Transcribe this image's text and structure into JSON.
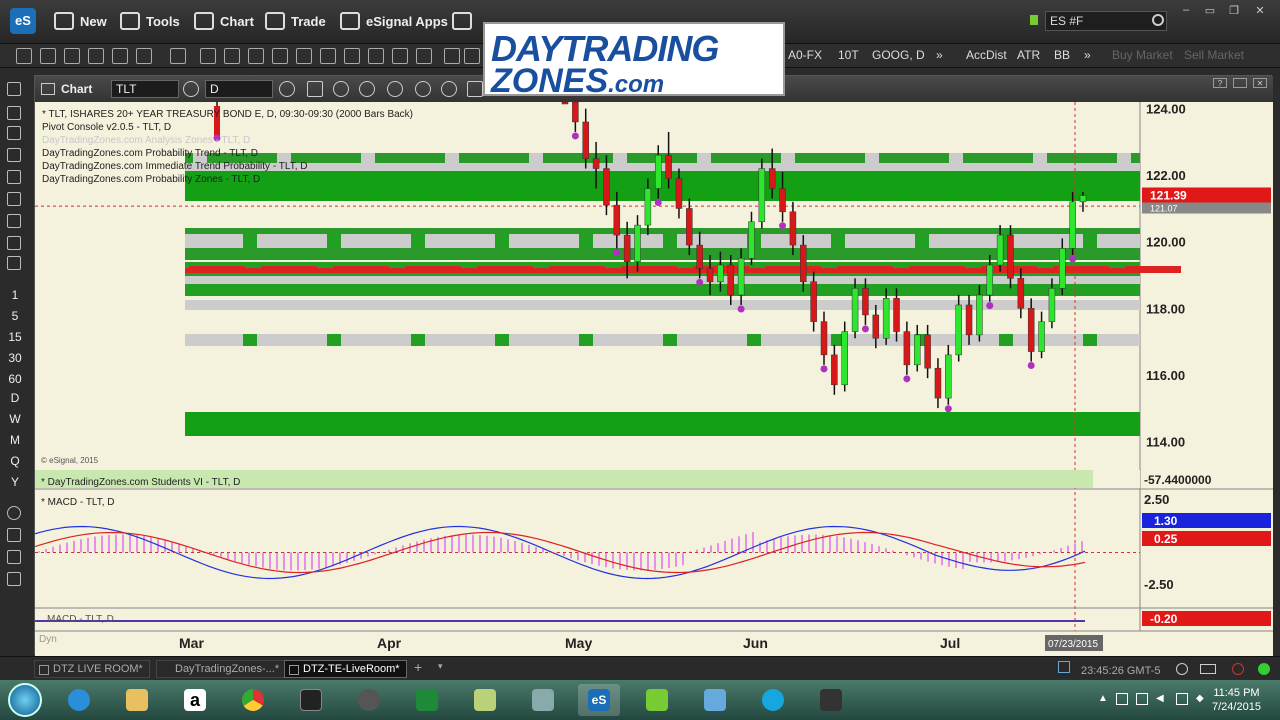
{
  "app": {
    "logo_text": "eS"
  },
  "menu": [
    {
      "label": "New",
      "icon": "new-icon"
    },
    {
      "label": "Tools",
      "icon": "tools-icon"
    },
    {
      "label": "Chart",
      "icon": "chart-icon"
    },
    {
      "label": "Trade",
      "icon": "trade-icon"
    },
    {
      "label": "eSignal Apps",
      "icon": "esignal-apps-icon"
    }
  ],
  "symbol_search": "ES #F",
  "toolbar2": {
    "items": [
      "A0-FX",
      "10T",
      "GOOG, D",
      "AccDist",
      "ATR",
      "BB"
    ],
    "disabled": [
      "Buy Market",
      "Sell Market"
    ]
  },
  "overlay_logo": {
    "line1": "DAYTRADING",
    "line2": "ZONES",
    "suffix": ".com"
  },
  "left_intervals": [
    "1",
    "5",
    "15",
    "30",
    "60",
    "D",
    "W",
    "M",
    "Q",
    "Y"
  ],
  "chart_window": {
    "title": "Chart",
    "symbol": "TLT",
    "interval": "D"
  },
  "legend": {
    "line1": "* TLT, ISHARES 20+ YEAR TREASURY BOND E, D, 09:30-09:30 (2000 Bars Back)",
    "line2": "Pivot Console v2.0.5 - TLT, D",
    "line3": "DayTradingZones.com Analysis Zones - TLT, D",
    "line4": "DayTradingZones.com Probability Trend - TLT, D",
    "line5": "DayTradingZones.com Immediate Trend Probability - TLT, D",
    "line6": "DayTradingZones.com Probability Zones - TLT, D"
  },
  "copyright": "© eSignal, 2015",
  "students_vi": {
    "label": "* DayTradingZones.com Students VI - TLT, D",
    "value": "-57.4400000"
  },
  "macd": {
    "label": "* MACD - TLT, D",
    "upper": "2.50",
    "lower": "-2.50",
    "blue_value": "1.30",
    "red_value": "0.25"
  },
  "macd2": {
    "label": "MACD - TLT, D",
    "value": "-0.20"
  },
  "dyn_label": "Dyn",
  "cursor_date": "07/23/2015",
  "tabs": [
    "DTZ LIVE ROOM*",
    "DayTradingZones-...*",
    "DTZ-TE-LiveRoom*"
  ],
  "status_clock": "23:45:26 GMT-5",
  "system_time": {
    "time": "11:45 PM",
    "date": "7/24/2015"
  },
  "chart_data": {
    "type": "candlestick",
    "title": "TLT, ISHARES 20+ YEAR TREASURY BOND E, D",
    "x_ticks": [
      "Mar",
      "Apr",
      "May",
      "Jun",
      "Jul"
    ],
    "y_ticks": [
      "124.00",
      "122.00",
      "120.00",
      "118.00",
      "116.00",
      "114.00"
    ],
    "ylim": [
      113.2,
      124.2
    ],
    "last_price": "121.39",
    "ref_price": "121.07",
    "candles": [
      [
        125.8,
        126.3,
        124.6,
        124.9
      ],
      [
        124.9,
        125.2,
        123.3,
        123.6
      ],
      [
        123.6,
        124.0,
        122.2,
        122.5
      ],
      [
        122.5,
        123.0,
        121.6,
        122.2
      ],
      [
        122.2,
        122.6,
        120.8,
        121.1
      ],
      [
        121.1,
        121.5,
        119.8,
        120.2
      ],
      [
        120.2,
        120.6,
        118.9,
        119.4
      ],
      [
        119.4,
        120.8,
        119.1,
        120.5
      ],
      [
        120.5,
        121.9,
        120.2,
        121.6
      ],
      [
        121.6,
        122.9,
        121.3,
        122.6
      ],
      [
        122.6,
        123.3,
        121.6,
        121.9
      ],
      [
        121.9,
        122.2,
        120.7,
        121.0
      ],
      [
        121.0,
        121.3,
        119.6,
        119.9
      ],
      [
        119.9,
        120.3,
        118.9,
        119.2
      ],
      [
        119.2,
        119.6,
        118.4,
        118.8
      ],
      [
        118.8,
        119.7,
        118.5,
        119.3
      ],
      [
        119.3,
        119.6,
        118.1,
        118.4
      ],
      [
        118.4,
        119.8,
        118.1,
        119.5
      ],
      [
        119.5,
        120.9,
        119.3,
        120.6
      ],
      [
        120.6,
        122.5,
        120.4,
        122.2
      ],
      [
        122.2,
        122.8,
        121.3,
        121.6
      ],
      [
        121.6,
        122.1,
        120.6,
        120.9
      ],
      [
        120.9,
        121.2,
        119.6,
        119.9
      ],
      [
        119.9,
        120.2,
        118.5,
        118.8
      ],
      [
        118.8,
        119.1,
        117.3,
        117.6
      ],
      [
        117.6,
        117.9,
        116.3,
        116.6
      ],
      [
        116.6,
        116.9,
        115.4,
        115.7
      ],
      [
        115.7,
        117.6,
        115.5,
        117.3
      ],
      [
        117.3,
        118.9,
        117.1,
        118.6
      ],
      [
        118.6,
        118.9,
        117.5,
        117.8
      ],
      [
        117.8,
        118.1,
        116.8,
        117.1
      ],
      [
        117.1,
        118.6,
        116.9,
        118.3
      ],
      [
        118.3,
        118.6,
        117.0,
        117.3
      ],
      [
        117.3,
        117.6,
        116.0,
        116.3
      ],
      [
        116.3,
        117.5,
        116.1,
        117.2
      ],
      [
        117.2,
        117.5,
        115.9,
        116.2
      ],
      [
        116.2,
        116.5,
        115.0,
        115.3
      ],
      [
        115.3,
        116.9,
        115.1,
        116.6
      ],
      [
        116.6,
        118.4,
        116.4,
        118.1
      ],
      [
        118.1,
        118.4,
        116.9,
        117.2
      ],
      [
        117.2,
        118.7,
        117.0,
        118.4
      ],
      [
        118.4,
        119.6,
        118.2,
        119.3
      ],
      [
        119.3,
        120.5,
        119.1,
        120.2
      ],
      [
        120.2,
        120.5,
        118.6,
        118.9
      ],
      [
        118.9,
        119.2,
        117.7,
        118.0
      ],
      [
        118.0,
        118.3,
        116.4,
        116.7
      ],
      [
        116.7,
        117.9,
        116.5,
        117.6
      ],
      [
        117.6,
        118.9,
        117.4,
        118.6
      ],
      [
        118.6,
        120.1,
        118.4,
        119.8
      ],
      [
        119.8,
        121.5,
        119.6,
        121.2
      ],
      [
        121.2,
        121.5,
        120.9,
        121.39
      ]
    ]
  }
}
